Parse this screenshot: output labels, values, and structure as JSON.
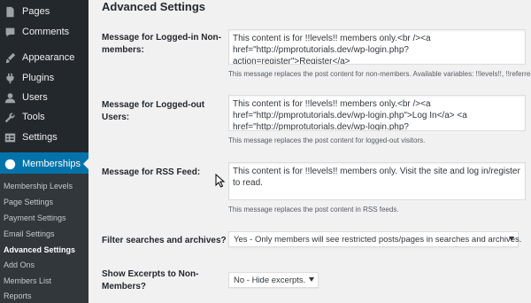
{
  "sidebar": {
    "items": [
      {
        "label": "Pages",
        "icon": "pages-icon"
      },
      {
        "label": "Comments",
        "icon": "comments-icon"
      },
      {
        "label": "Appearance",
        "icon": "appearance-icon"
      },
      {
        "label": "Plugins",
        "icon": "plugins-icon"
      },
      {
        "label": "Users",
        "icon": "users-icon"
      },
      {
        "label": "Tools",
        "icon": "tools-icon"
      },
      {
        "label": "Settings",
        "icon": "settings-icon"
      },
      {
        "label": "Memberships",
        "icon": "memberships-icon"
      }
    ],
    "submenu": [
      "Membership Levels",
      "Page Settings",
      "Payment Settings",
      "Email Settings",
      "Advanced Settings",
      "Add Ons",
      "Members List",
      "Reports"
    ],
    "current_submenu": "Advanced Settings",
    "active_color": "#0073aa",
    "bg_color": "#23282d"
  },
  "main": {
    "title": "Advanced Settings",
    "fields": {
      "logged_in": {
        "label": "Message for Logged-in Non-members:",
        "value": "This content is for !!levels!! members only.<br /><a href=\"http://pmprotutorials.dev/wp-login.php?action=register\">Register</a>",
        "description": "This message replaces the post content for non-members. Available variables: !!levels!!, !!referrer!!"
      },
      "logged_out": {
        "label": "Message for Logged-out Users:",
        "value": "This content is for !!levels!! members only.<br /><a href=\"http://pmprotutorials.dev/wp-login.php\">Log In</a> <a href=\"http://pmprotutorials.dev/wp-login.php?action=register\">Register</a>",
        "description": "This message replaces the post content for logged-out visitors."
      },
      "rss": {
        "label": "Message for RSS Feed:",
        "value": "This content is for !!levels!! members only. Visit the site and log in/register to read.",
        "description": "This message replaces the post content in RSS feeds."
      },
      "filter_searches": {
        "label": "Filter searches and archives?",
        "value": "Yes - Only members will see restricted posts/pages in searches and archives."
      },
      "show_excerpts": {
        "label": "Show Excerpts to Non-Members?",
        "value": "No - Hide excerpts."
      }
    }
  }
}
